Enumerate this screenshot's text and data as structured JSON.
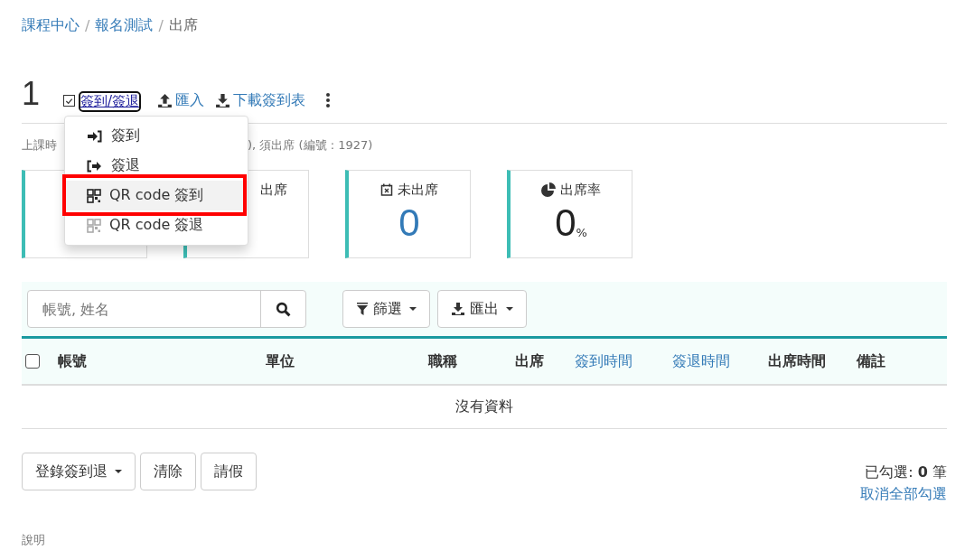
{
  "breadcrumb": [
    {
      "label": "課程中心",
      "link": true,
      "separator": "/"
    },
    {
      "label": "報名測試",
      "link": true,
      "separator": "/"
    },
    {
      "label": "出席",
      "link": false
    }
  ],
  "title": "1",
  "toolbar": {
    "checked": true,
    "signin_label": "簽到/簽退",
    "import_label": "匯入",
    "download_label": "下載簽到表"
  },
  "dropdown": {
    "items": [
      {
        "kind": "signin",
        "label": "簽到",
        "selected": false
      },
      {
        "kind": "signout",
        "label": "簽退",
        "selected": false
      },
      {
        "kind": "qr",
        "label": "QR code 簽到",
        "selected": true,
        "dimmed": false
      },
      {
        "kind": "qr",
        "label": "QR code 簽退",
        "selected": false,
        "dimmed": true
      }
    ]
  },
  "subtitle": {
    "part_1": "上課時",
    "part_2": "), 須出席 (編號 : 1927)"
  },
  "cards": [
    {
      "kind": "total"
    },
    {
      "kind": "present",
      "label": "出席"
    },
    {
      "kind": "absent",
      "label": "未出席",
      "value": "0"
    },
    {
      "kind": "rate",
      "label": "出席率",
      "value": "0",
      "unit": "%"
    }
  ],
  "search": {
    "placeholder": "帳號, 姓名"
  },
  "filter_buttons": [
    "篩選",
    "匯出"
  ],
  "table": {
    "checked": false,
    "columns": [
      {
        "label": "帳號",
        "sortable": false
      },
      {
        "label": "單位",
        "sortable": false
      },
      {
        "label": "職稱",
        "sortable": false
      },
      {
        "label": "出席",
        "sortable": false
      },
      {
        "label": "簽到時間",
        "sortable": true
      },
      {
        "label": "簽退時間",
        "sortable": true
      },
      {
        "label": "出席時間",
        "sortable": false
      },
      {
        "label": "備註",
        "sortable": false
      }
    ],
    "empty_text": "沒有資料"
  },
  "actions": [
    "登錄簽到退",
    "清除",
    "請假"
  ],
  "selection": {
    "text": "已勾選: **0** 筆",
    "clear_link": "取消全部勾選"
  },
  "footer_label": "說明"
}
